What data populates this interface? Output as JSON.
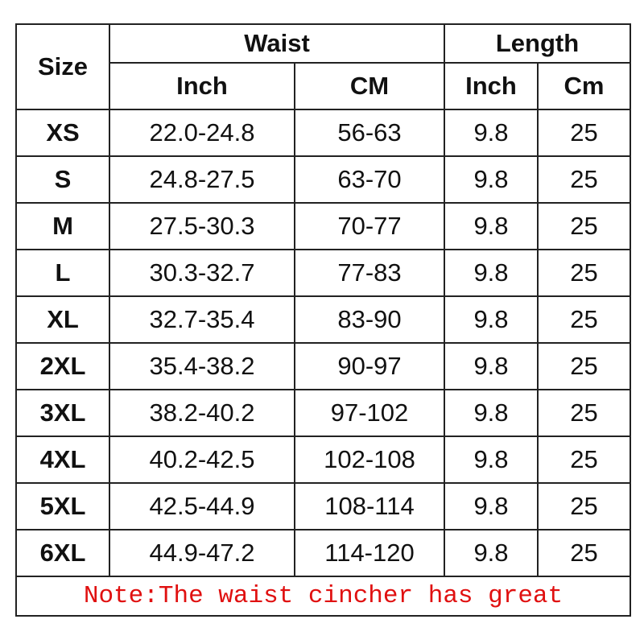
{
  "header": {
    "size": "Size",
    "waist": "Waist",
    "length": "Length",
    "waist_inch": "Inch",
    "waist_cm": "CM",
    "length_inch": "Inch",
    "length_cm": "Cm"
  },
  "rows": [
    {
      "size": "XS",
      "waist_inch": "22.0-24.8",
      "waist_cm": "56-63",
      "length_inch": "9.8",
      "length_cm": "25"
    },
    {
      "size": "S",
      "waist_inch": "24.8-27.5",
      "waist_cm": "63-70",
      "length_inch": "9.8",
      "length_cm": "25"
    },
    {
      "size": "M",
      "waist_inch": "27.5-30.3",
      "waist_cm": "70-77",
      "length_inch": "9.8",
      "length_cm": "25"
    },
    {
      "size": "L",
      "waist_inch": "30.3-32.7",
      "waist_cm": "77-83",
      "length_inch": "9.8",
      "length_cm": "25"
    },
    {
      "size": "XL",
      "waist_inch": "32.7-35.4",
      "waist_cm": "83-90",
      "length_inch": "9.8",
      "length_cm": "25"
    },
    {
      "size": "2XL",
      "waist_inch": "35.4-38.2",
      "waist_cm": "90-97",
      "length_inch": "9.8",
      "length_cm": "25"
    },
    {
      "size": "3XL",
      "waist_inch": "38.2-40.2",
      "waist_cm": "97-102",
      "length_inch": "9.8",
      "length_cm": "25"
    },
    {
      "size": "4XL",
      "waist_inch": "40.2-42.5",
      "waist_cm": "102-108",
      "length_inch": "9.8",
      "length_cm": "25"
    },
    {
      "size": "5XL",
      "waist_inch": "42.5-44.9",
      "waist_cm": "108-114",
      "length_inch": "9.8",
      "length_cm": "25"
    },
    {
      "size": "6XL",
      "waist_inch": "44.9-47.2",
      "waist_cm": "114-120",
      "length_inch": "9.8",
      "length_cm": "25"
    }
  ],
  "note": "Note:The waist cincher has great",
  "colors": {
    "note": "#e01010",
    "border": "#222222"
  }
}
